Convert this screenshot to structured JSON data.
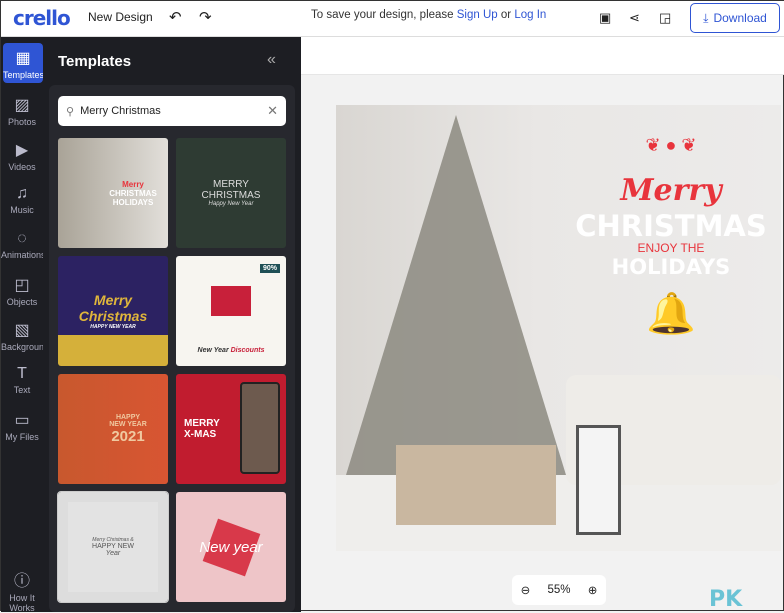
{
  "header": {
    "logo": "crello",
    "title": "New Design",
    "save_msg": "To save your design, please ",
    "sign_up": "Sign Up",
    "or": " or ",
    "log_in": "Log In",
    "download": "Download"
  },
  "nav": [
    {
      "label": "Templates",
      "icon": "grid-icon"
    },
    {
      "label": "Photos",
      "icon": "image-icon"
    },
    {
      "label": "Videos",
      "icon": "video-icon"
    },
    {
      "label": "Music",
      "icon": "music-icon"
    },
    {
      "label": "Animations",
      "icon": "animation-icon"
    },
    {
      "label": "Objects",
      "icon": "shapes-icon"
    },
    {
      "label": "Background",
      "icon": "background-icon"
    },
    {
      "label": "Text",
      "icon": "text-icon"
    },
    {
      "label": "My Files",
      "icon": "folder-icon"
    },
    {
      "label": "How It Works",
      "icon": "help-icon"
    }
  ],
  "panel": {
    "title": "Templates",
    "search_value": "Merry Christmas"
  },
  "templates": [
    {
      "l1": "Merry",
      "l2": "CHRISTMAS",
      "l3": "HOLIDAYS"
    },
    {
      "l1": "MERRY",
      "l2": "CHRISTMAS",
      "l3": "Happy New Year"
    },
    {
      "l1": "Merry",
      "l2": "Christmas",
      "l3": "HAPPY NEW YEAR"
    },
    {
      "l1": "New Year",
      "l2": "Discounts",
      "l3": "90%"
    },
    {
      "l1": "HAPPY",
      "l2": "NEW YEAR",
      "l3": "2021"
    },
    {
      "l1": "MERRY",
      "l2": "X-MAS",
      "l3": ""
    },
    {
      "l1": "Merry Christmas &",
      "l2": "HAPPY NEW",
      "l3": "Year"
    },
    {
      "l1": "New year",
      "l2": "",
      "l3": ""
    }
  ],
  "design": {
    "merry": "Merry",
    "christmas": "CHRISTMAS",
    "enjoy": "ENJOY THE",
    "holidays": "HOLIDAYS",
    "accent": "#e8343c"
  },
  "zoom": {
    "value": "55%"
  },
  "watermark": "PK"
}
